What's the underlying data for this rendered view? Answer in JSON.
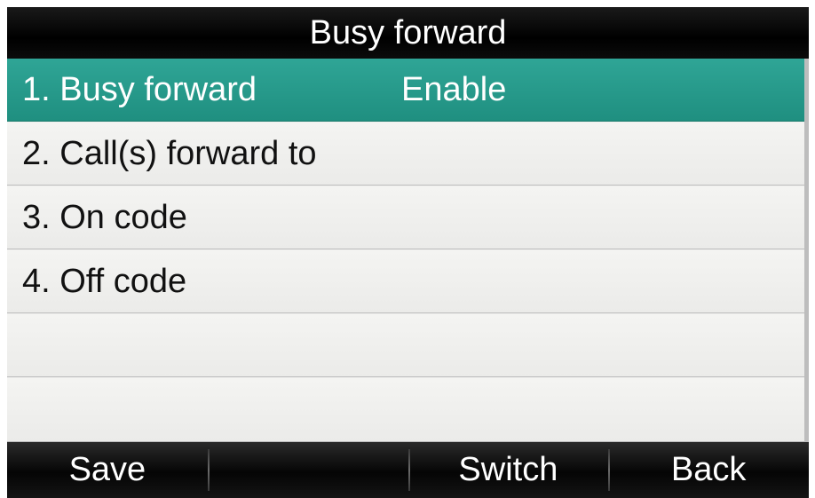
{
  "title_bar": {
    "title": "Busy forward"
  },
  "menu": {
    "items": [
      {
        "label": "1. Busy forward",
        "value": "Enable",
        "selected": true
      },
      {
        "label": "2. Call(s) forward to",
        "value": "",
        "selected": false
      },
      {
        "label": "3. On code",
        "value": "",
        "selected": false
      },
      {
        "label": "4. Off code",
        "value": "",
        "selected": false
      },
      {
        "label": "",
        "value": "",
        "selected": false
      },
      {
        "label": "",
        "value": "",
        "selected": false
      }
    ]
  },
  "softkeys": [
    {
      "label": "Save"
    },
    {
      "label": ""
    },
    {
      "label": "Switch"
    },
    {
      "label": "Back"
    }
  ],
  "colors": {
    "selected_row": "#26998a",
    "bar_background": "#000000",
    "row_background": "#efefed"
  }
}
